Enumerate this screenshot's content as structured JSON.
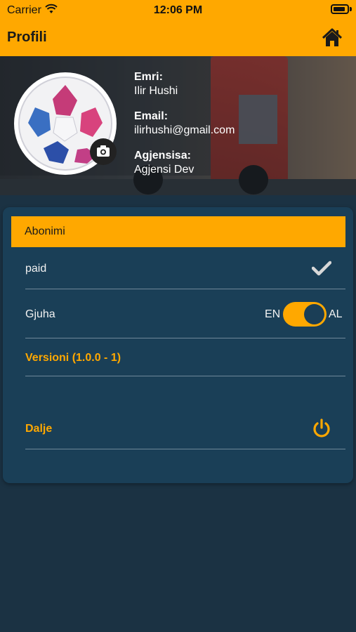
{
  "status_bar": {
    "carrier": "Carrier",
    "time": "12:06 PM"
  },
  "nav": {
    "title": "Profili",
    "home_icon": "home-icon"
  },
  "profile": {
    "name_label": "Emri:",
    "name_value": "Ilir Hushi",
    "email_label": "Email:",
    "email_value": "ilirhushi@gmail.com",
    "agency_label": "Agjensisa:",
    "agency_value": "Agjensi Dev"
  },
  "settings": {
    "subscription_header": "Abonimi",
    "subscription_status": "paid",
    "language_label": "Gjuha",
    "lang_left": "EN",
    "lang_right": "AL",
    "version_label": "Versioni (1.0.0 - 1)",
    "logout_label": "Dalje"
  },
  "colors": {
    "accent": "#ffa800",
    "background": "#1b3243",
    "card": "#1a3f57",
    "divider": "#6f8899"
  }
}
